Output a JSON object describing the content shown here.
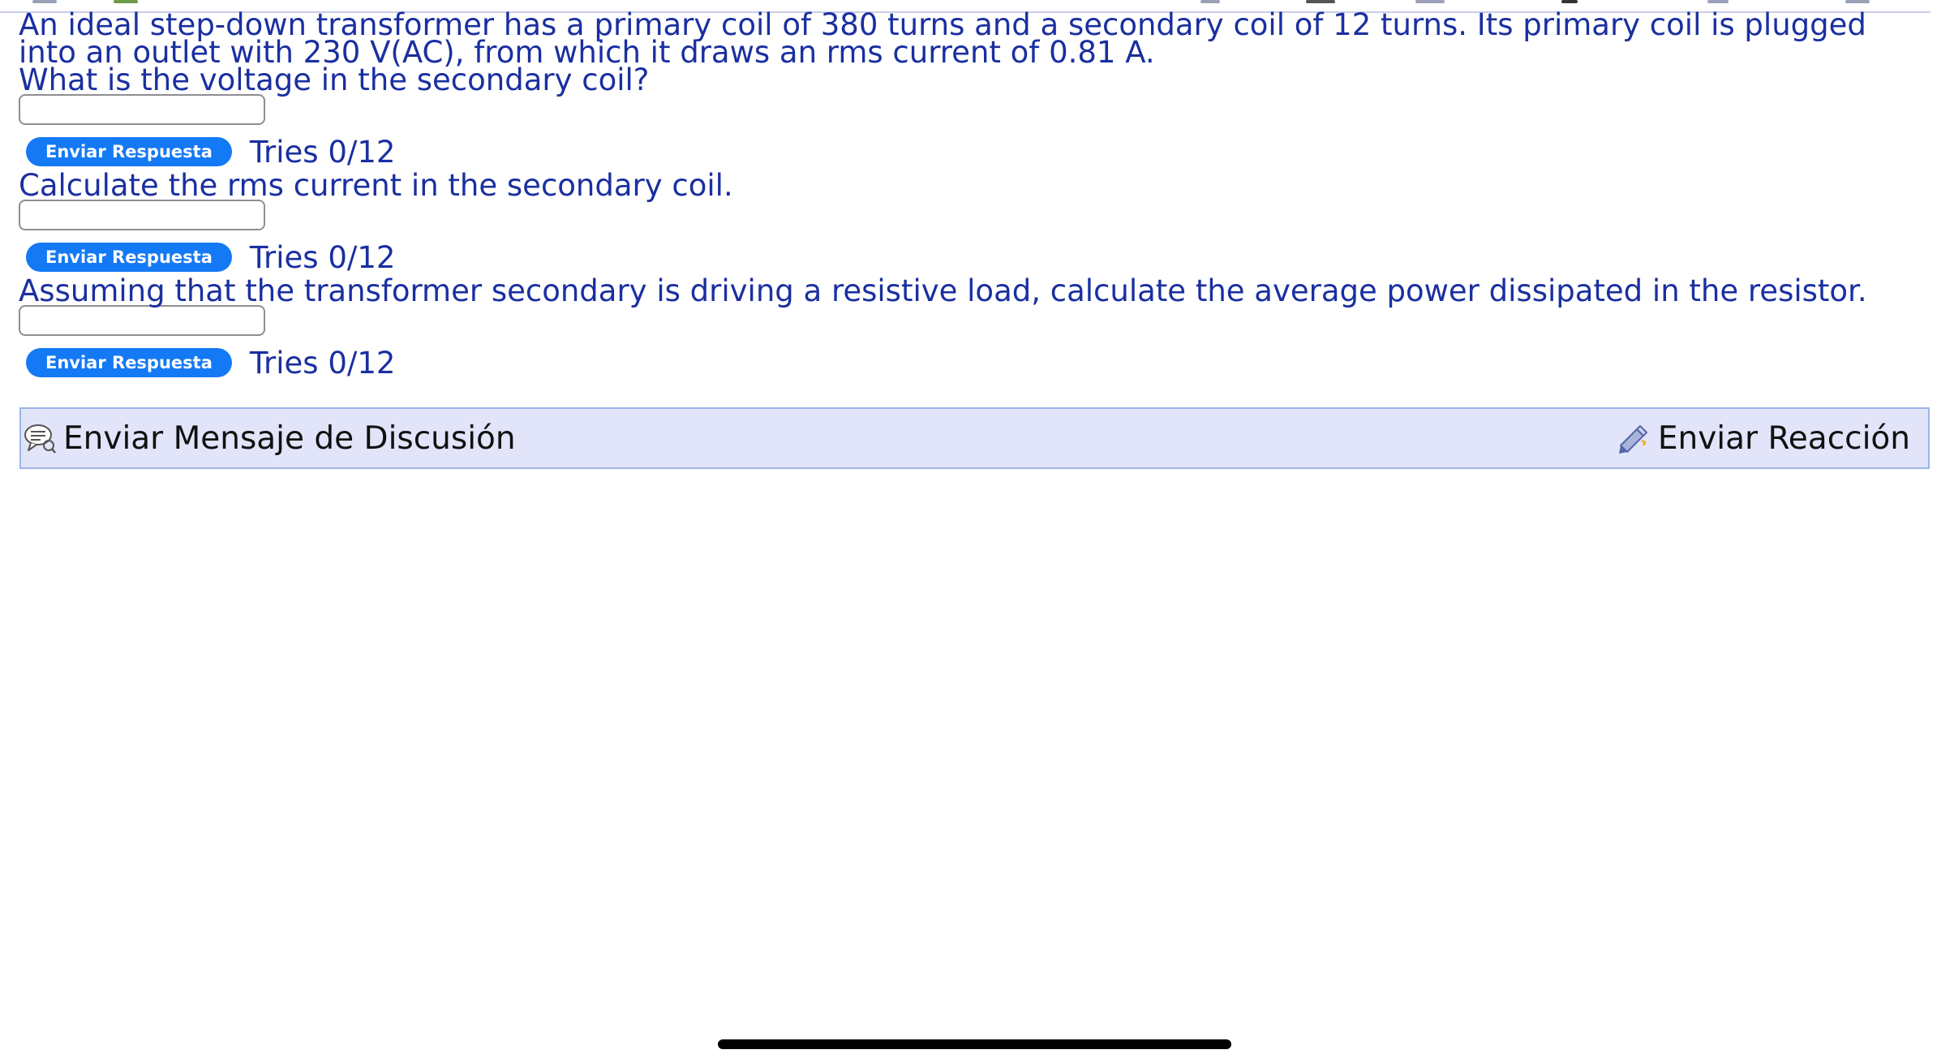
{
  "problem": {
    "statement": "An ideal step-down transformer has a primary coil of 380 turns and a secondary coil of 12 turns. Its primary coil is plugged into an outlet with 230 V(AC), from which it draws an rms current of 0.81 A."
  },
  "parts": [
    {
      "question": "What is the voltage in the secondary coil?",
      "input_value": "",
      "submit_label": "Enviar Respuesta",
      "tries": "Tries 0/12"
    },
    {
      "question": "Calculate the rms current in the secondary coil.",
      "input_value": "",
      "submit_label": "Enviar Respuesta",
      "tries": "Tries 0/12"
    },
    {
      "question": "Assuming that the transformer secondary is driving a resistive load, calculate the average power dissipated in the resistor.",
      "input_value": "",
      "submit_label": "Enviar Respuesta",
      "tries": "Tries 0/12"
    }
  ],
  "footer_bar": {
    "discussion_label": "Enviar Mensaje de Discusión",
    "discussion_icon": "speech-bubble-icon",
    "feedback_label": "Enviar Reacción",
    "feedback_icon": "pencil-feedback-icon"
  },
  "colors": {
    "question_text": "#1a2fa0",
    "submit_button": "#1479f5",
    "bar_background": "#e2e4f9",
    "bar_border": "#9db4e8"
  }
}
